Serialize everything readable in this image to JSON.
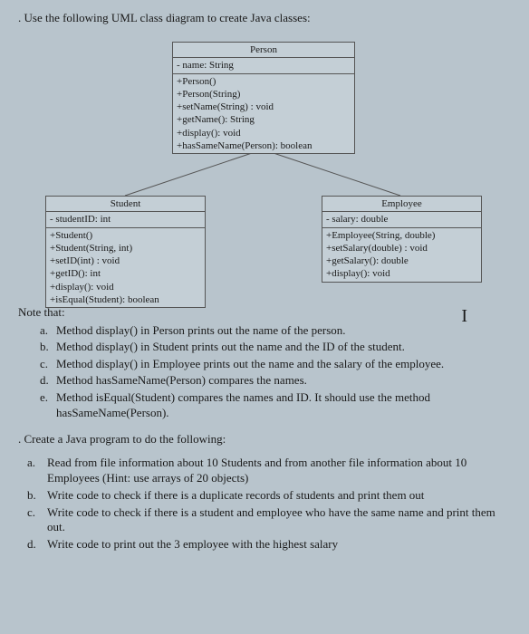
{
  "title_prefix": ". ",
  "title": "Use the following UML class diagram to create Java classes:",
  "uml": {
    "person": {
      "name": "Person",
      "attrs": [
        "- name: String"
      ],
      "ops": [
        "+Person()",
        "+Person(String)",
        "+setName(String) : void",
        "+getName(): String",
        "+display(): void",
        "+hasSameName(Person): boolean"
      ]
    },
    "student": {
      "name": "Student",
      "attrs": [
        "- studentID: int"
      ],
      "ops": [
        "+Student()",
        "+Student(String, int)",
        "+setID(int) : void",
        "+getID(): int",
        "+display(): void",
        "+isEqual(Student): boolean"
      ]
    },
    "employee": {
      "name": "Employee",
      "attrs": [
        "- salary: double"
      ],
      "ops": [
        "+Employee(String, double)",
        "+setSalary(double) : void",
        "+getSalary(): double",
        "+display(): void"
      ]
    }
  },
  "notes": {
    "heading": "Note that:",
    "items": [
      "Method display() in Person prints out the name of the person.",
      "Method display() in Student prints out the name and the ID of the student.",
      "Method display() in Employee prints out the name and the salary of the employee.",
      "Method hasSameName(Person) compares the names.",
      "Method isEqual(Student) compares the names and ID. It should use the method hasSameName(Person)."
    ],
    "labels": [
      "a.",
      "b.",
      "c.",
      "d.",
      "e."
    ]
  },
  "tasks": {
    "heading_prefix": ". ",
    "heading": "Create a Java program to do the following:",
    "items": [
      "Read from file information about 10 Students and from another file information about 10 Employees (Hint: use arrays of 20 objects)",
      "Write code to check if there is a duplicate records of students and print them out",
      "Write code to check if there is a student and employee who have the same name and print them out.",
      "Write code to print out the 3 employee with the highest salary"
    ],
    "labels": [
      "a.",
      "b.",
      "c.",
      "d."
    ]
  },
  "cursor": "I"
}
